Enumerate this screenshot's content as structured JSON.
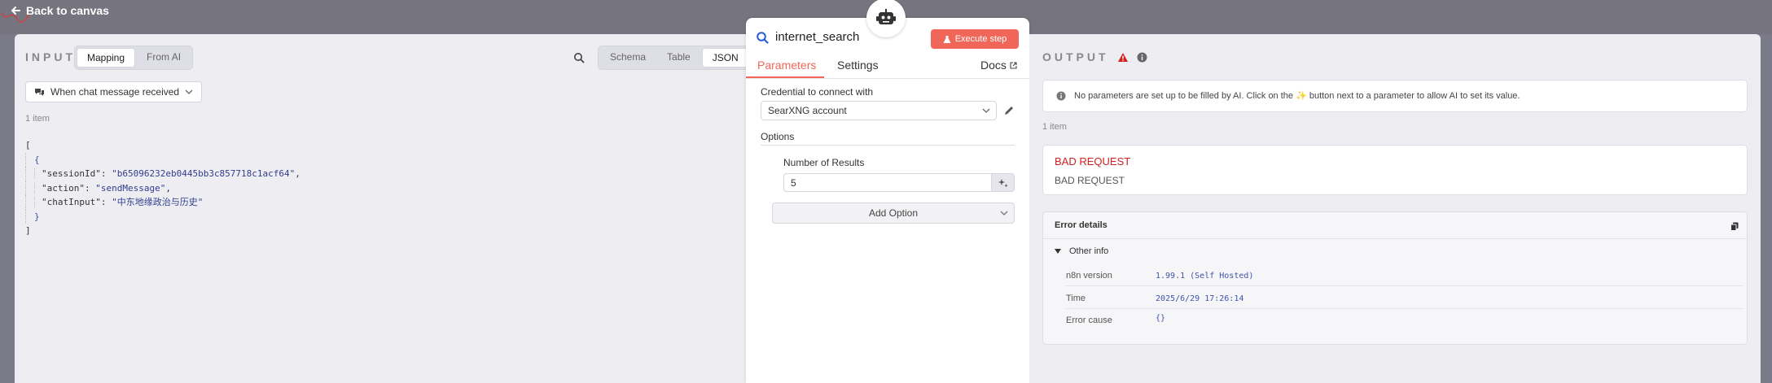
{
  "topbar": {
    "back_label": "Back to canvas"
  },
  "input": {
    "title": "INPUT",
    "mode_options": [
      "Mapping",
      "From AI"
    ],
    "view_options": [
      "Schema",
      "Table",
      "JSON"
    ],
    "source_node": "When chat message received",
    "item_count": "1 item",
    "json": {
      "open_bracket": "[",
      "open_brace": "{",
      "rows": [
        {
          "key": "\"sessionId\"",
          "value": "\"b65096232eb0445bb3c857718c1acf64\""
        },
        {
          "key": "\"action\"",
          "value": "\"sendMessage\""
        },
        {
          "key": "\"chatInput\"",
          "value": "\"中东地缘政治与历史\""
        }
      ],
      "close_brace": "}",
      "close_bracket": "]"
    }
  },
  "node": {
    "name": "internet_search",
    "execute_label": "Execute step",
    "tabs": [
      "Parameters",
      "Settings"
    ],
    "docs_label": "Docs",
    "credential_label": "Credential to connect with",
    "credential_value": "SearXNG account",
    "options_label": "Options",
    "num_results_label": "Number of Results",
    "num_results_value": "5",
    "add_option_label": "Add Option"
  },
  "output": {
    "title": "OUTPUT",
    "info_message": "No parameters are set up to be filled by AI. Click on the ✨ button next to a parameter to allow AI to set its value.",
    "item_count": "1 item",
    "error_title": "BAD REQUEST",
    "error_subtitle": "BAD REQUEST",
    "details_title": "Error details",
    "other_info_label": "Other info",
    "details": [
      {
        "key": "n8n version",
        "value": "1.99.1 (Self Hosted)"
      },
      {
        "key": "Time",
        "value": "2025/6/29 17:26:14"
      },
      {
        "key": "Error cause",
        "value": "{}"
      }
    ]
  },
  "colors": {
    "accent": "#f0675a",
    "error": "#d0211e",
    "string": "#2f3d8e"
  }
}
